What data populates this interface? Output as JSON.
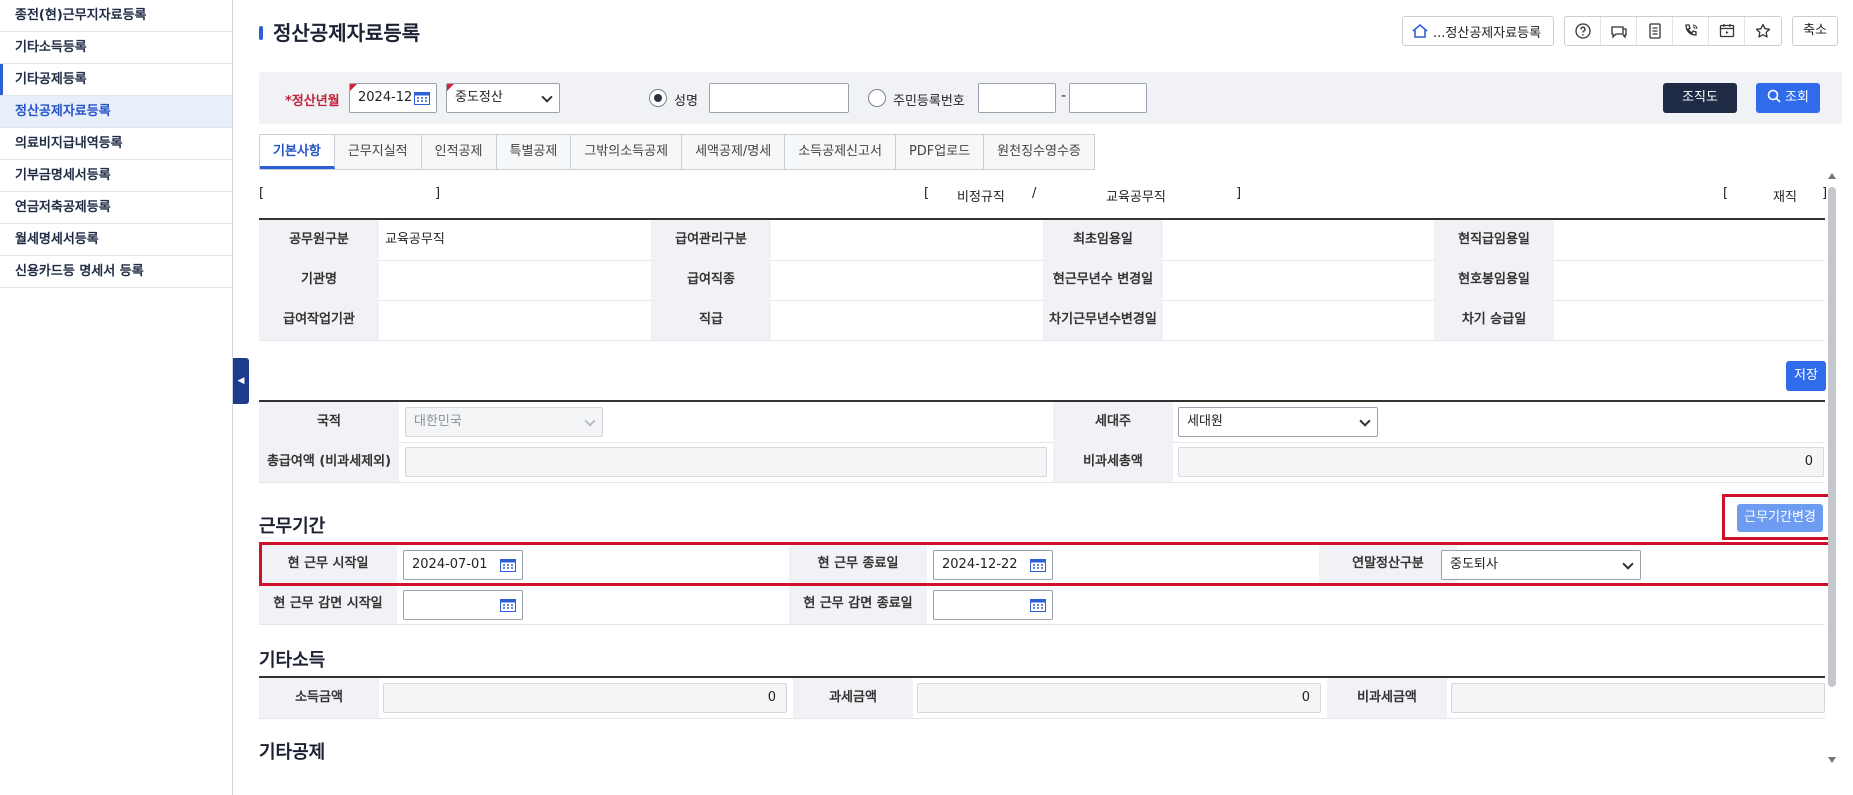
{
  "sidebar": {
    "items": [
      {
        "label": "종전(현)근무지자료등록"
      },
      {
        "label": "기타소득등록"
      },
      {
        "label": "기타공제등록"
      },
      {
        "label": "정산공제자료등록"
      },
      {
        "label": "의료비지급내역등록"
      },
      {
        "label": "기부금명세서등록"
      },
      {
        "label": "연금저축공제등록"
      },
      {
        "label": "월세명세서등록"
      },
      {
        "label": "신용카드등 명세서 등록"
      }
    ],
    "collapse_glyph": "◀"
  },
  "header": {
    "title": "정산공제자료등록",
    "breadcrumb_label": "...정산공제자료등록",
    "shrink_label": "축소",
    "icons": [
      "help-icon",
      "chat-icon",
      "document-icon",
      "phone-icon",
      "calendar-window-icon",
      "star-icon"
    ]
  },
  "search": {
    "period_label": "*정산년월",
    "period_value": "2024-12",
    "settle_type_value": "중도정산",
    "name_radio_label": "성명",
    "name_value": "",
    "rrn_radio_label": "주민등록번호",
    "rrn_front": "",
    "rrn_back": "",
    "dash": "-",
    "org_button": "조직도",
    "search_button": "조회"
  },
  "tabs": [
    "기본사항",
    "근무지실적",
    "인적공제",
    "특별공제",
    "그밖의소득공제",
    "세액공제/명세",
    "소득공제신고서",
    "PDF업로드",
    "원천징수영수증"
  ],
  "info_line": {
    "left_open": "[",
    "left_close": "]",
    "mid_open": "[",
    "employment_type": "비정규직",
    "slash": "/",
    "job_type": "교육공무직",
    "mid_close": "]",
    "right_open": "[",
    "status": "재직",
    "right_close": "]"
  },
  "basic": {
    "labels": [
      "공무원구분",
      "급여관리구분",
      "최초임용일",
      "현직급임용일",
      "기관명",
      "급여직종",
      "현근무년수 변경일",
      "현호봉임용일",
      "급여작업기관",
      "직급",
      "차기근무년수변경일",
      "차기 승급일"
    ],
    "civil_type_value": "교육공무직"
  },
  "save_button": "저장",
  "household": {
    "nationality_label": "국적",
    "nationality_value": "대한민국",
    "householder_label": "세대주",
    "householder_value": "세대원",
    "total_pay_label": "총급여액 (비과세제외)",
    "nontax_total_label": "비과세총액",
    "nontax_total_value": "0"
  },
  "work_period": {
    "title": "근무기간",
    "change_button": "근무기간변경",
    "start_label": "현 근무 시작일",
    "start_value": "2024-07-01",
    "end_label": "현 근무 종료일",
    "end_value": "2024-12-22",
    "settle_label": "연말정산구분",
    "settle_value": "중도퇴사",
    "reduce_start_label": "현 근무 감면 시작일",
    "reduce_start_value": "",
    "reduce_end_label": "현 근무 감면 종료일",
    "reduce_end_value": ""
  },
  "other_income": {
    "title": "기타소득",
    "income_label": "소득금액",
    "income_value": "0",
    "taxable_label": "과세금액",
    "taxable_value": "0",
    "nontax_label": "비과세금액",
    "nontax_value": ""
  },
  "other_deduction": {
    "title": "기타공제"
  },
  "colors": {
    "accent": "#2f5fd6",
    "primary_button": "#2f6bea",
    "dark_button": "#1f2a44",
    "required_red": "#c0233b",
    "highlight_box": "#d0112b"
  }
}
